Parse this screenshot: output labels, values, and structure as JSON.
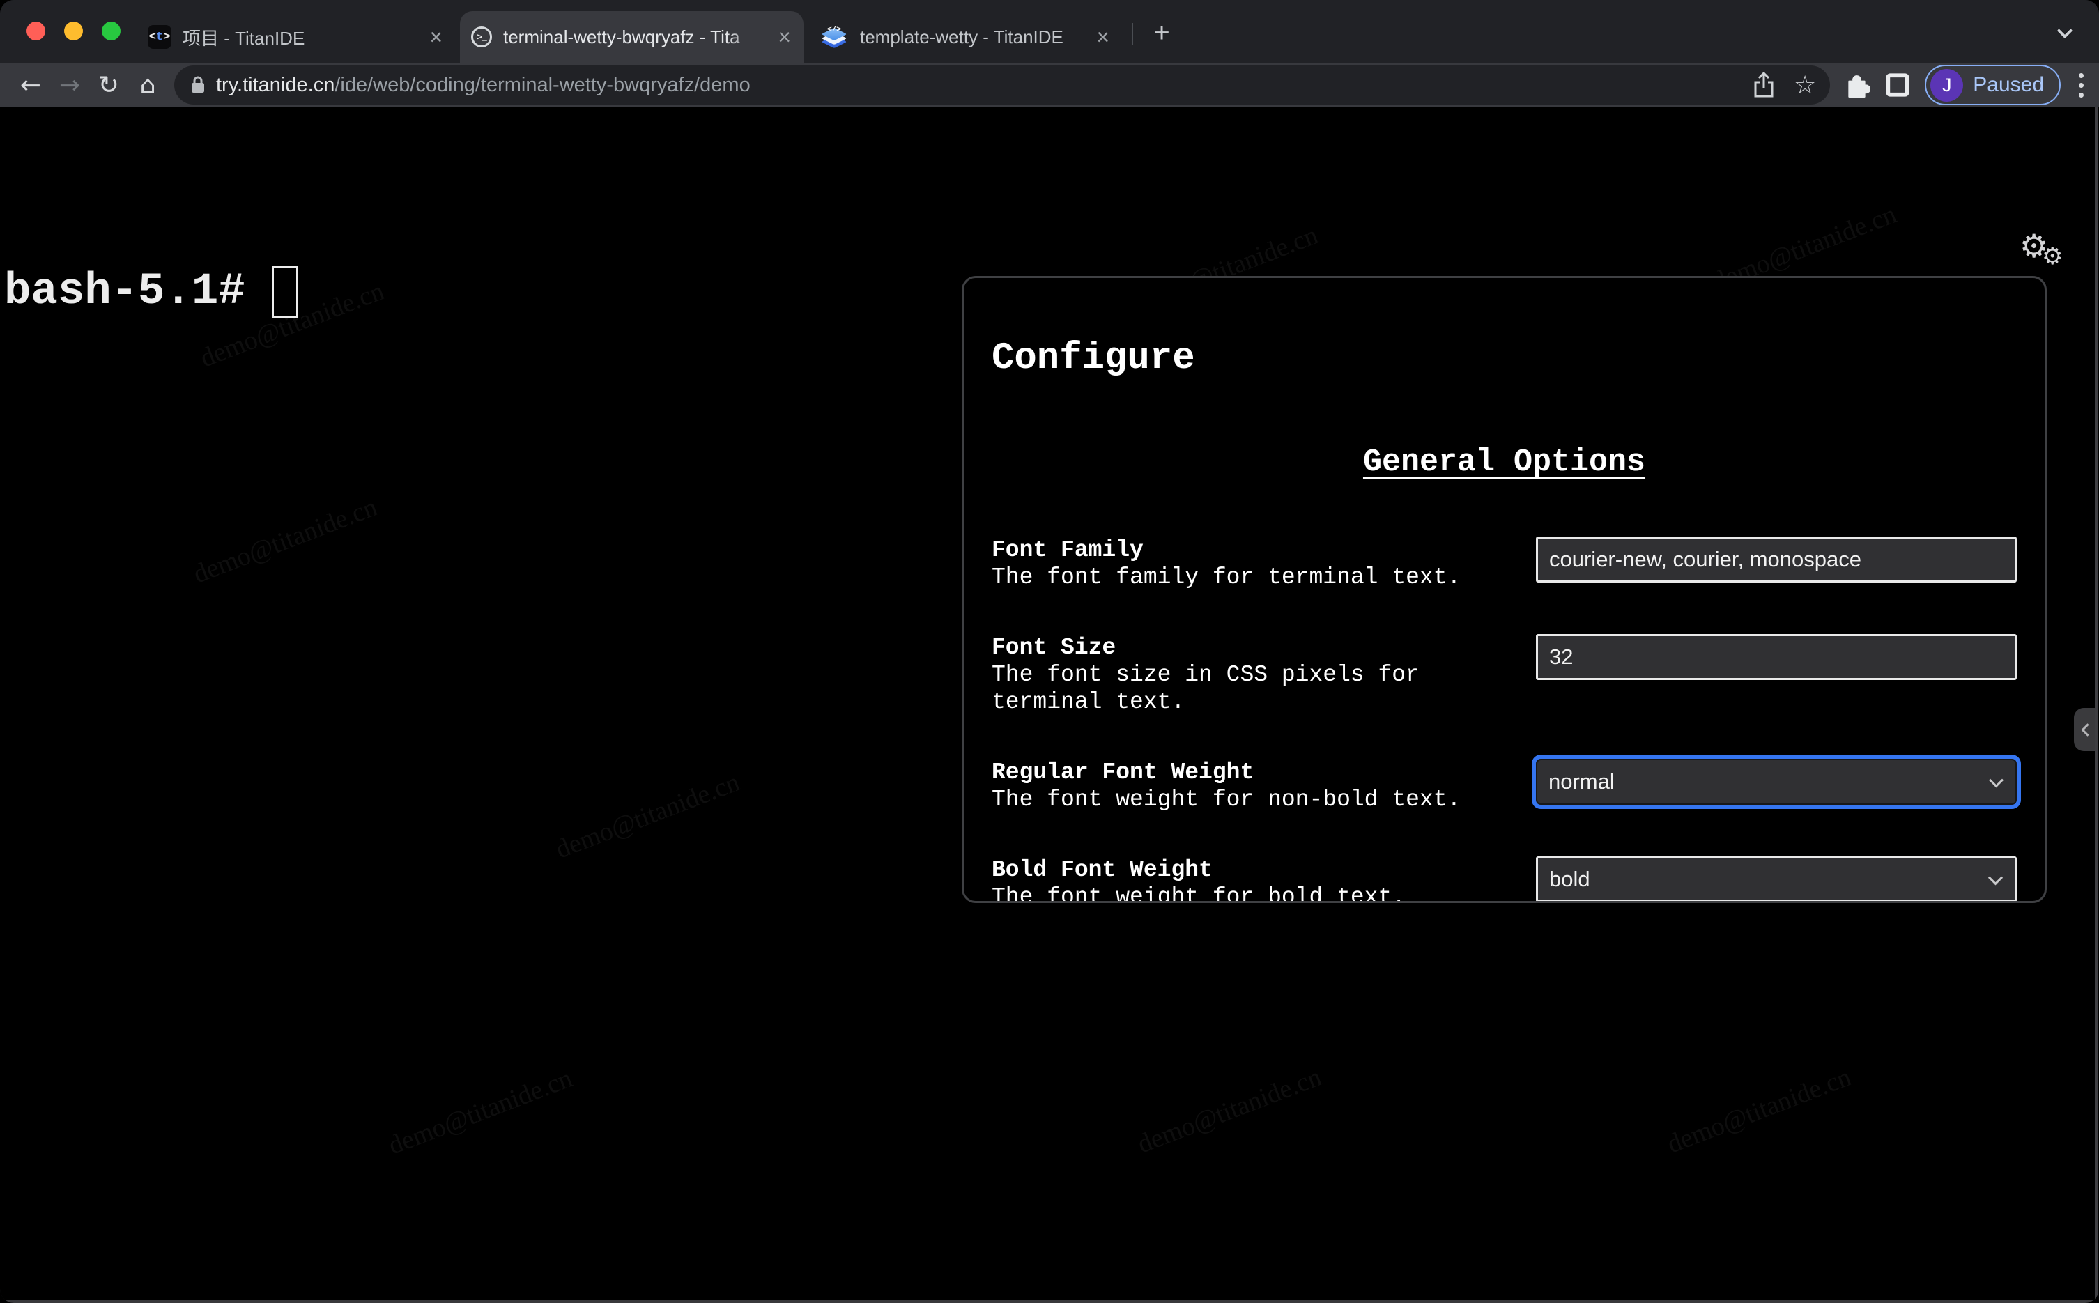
{
  "browser": {
    "tabs": [
      {
        "title": "项目 - TitanIDE"
      },
      {
        "title": "terminal-wetty-bwqryafz - Tita"
      },
      {
        "title": "template-wetty - TitanIDE"
      }
    ],
    "tab1_favicon": {
      "bracket_left": "<",
      "letter": "t",
      "bracket_right": ">"
    },
    "tab2_favicon_glyph": ">_",
    "tab3_favicon_glyph": "</>",
    "close_label": "×",
    "new_tab_label": "+",
    "toolbar": {
      "back_icon": "←",
      "forward_icon": "→",
      "reload_icon": "↻",
      "home_icon": "⌂",
      "url_host": "try.titanide.cn",
      "url_path": "/ide/web/coding/terminal-wetty-bwqryafz/demo",
      "star_icon": "☆",
      "profile_initial": "J",
      "profile_status": "Paused"
    }
  },
  "terminal": {
    "prompt": "bash-5.1#",
    "gear_icon": "⚙"
  },
  "watermark": {
    "text": "demo@titanide.cn"
  },
  "configure": {
    "title": "Configure",
    "section": "General Options",
    "fields": [
      {
        "label": "Font Family",
        "description": "The font family for terminal text.",
        "value": "courier-new, courier, monospace"
      },
      {
        "label": "Font Size",
        "description": "The font size in CSS pixels for terminal text.",
        "value": "32"
      },
      {
        "label": "Regular Font Weight",
        "description": "The font weight for non-bold text.",
        "value": "normal"
      },
      {
        "label": "Bold Font Weight",
        "description": "The font weight for bold text.",
        "value": "bold"
      }
    ]
  },
  "colors": {
    "accent": "#3575f0",
    "frame": "#212226",
    "toolbar": "#38393e",
    "page": "#000000",
    "profile-avatar": "#5b35b5",
    "paused-text": "#a9c6f7",
    "pill-border": "#87aef5",
    "close-red": "#ff5f57",
    "min-yellow": "#febc2e",
    "max-green": "#28c840",
    "input-bg": "#303033",
    "input-border": "#e9e9e9",
    "panel-border": "#3f4043"
  }
}
